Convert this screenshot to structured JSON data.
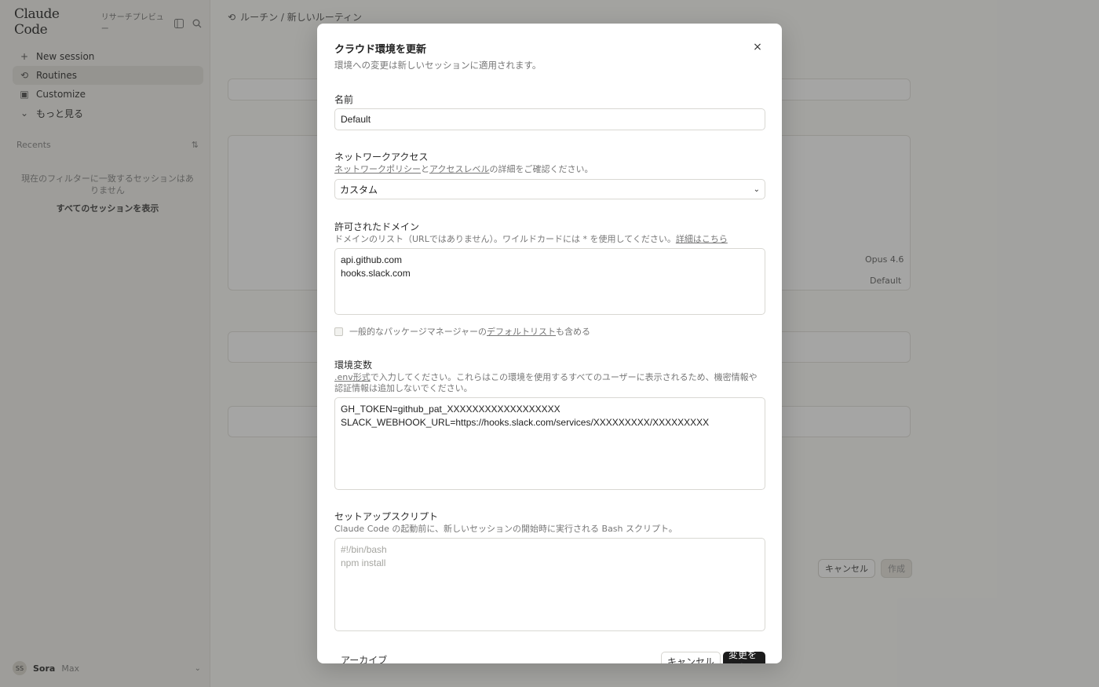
{
  "sidebar": {
    "brand": "Claude Code",
    "preview_tag": "リサーチプレビュー",
    "nav": [
      {
        "icon": "+",
        "label": "New session"
      },
      {
        "icon": "⟲",
        "label": "Routines"
      },
      {
        "icon": "▣",
        "label": "Customize"
      },
      {
        "icon": "⌄",
        "label": "もっと見る"
      }
    ],
    "recents_label": "Recents",
    "recents_icon": "⇅",
    "empty_message": "現在のフィルターに一致するセッションはありません",
    "show_all": "すべてのセッションを表示",
    "user": {
      "initials": "SS",
      "name": "Sora",
      "plan": "Max"
    }
  },
  "main": {
    "breadcrumb": "ルーチン / 新しいルーティン",
    "model_label": "Opus 4.6",
    "env_label": "Default",
    "cancel_label": "キャンセル",
    "create_label": "作成"
  },
  "modal": {
    "title": "クラウド環境を更新",
    "subtitle": "環境への変更は新しいセッションに適用されます。",
    "close_label": "×",
    "name": {
      "label": "名前",
      "value": "Default"
    },
    "network": {
      "label": "ネットワークアクセス",
      "hint_link1": "ネットワークポリシー",
      "hint_mid": "と",
      "hint_link2": "アクセスレベル",
      "hint_end": "の詳細をご確認ください。",
      "value": "カスタム"
    },
    "domains": {
      "label": "許可されたドメイン",
      "hint": "ドメインのリスト（URLではありません）。ワイルドカードには * を使用してください。",
      "hint_link": "詳細はこちら",
      "value": "api.github.com\nhooks.slack.com"
    },
    "default_list": {
      "pre": "一般的なパッケージマネージャーの",
      "link": "デフォルトリスト",
      "post": "も含める"
    },
    "env_vars": {
      "label": "環境変数",
      "hint_link": ".env形式",
      "hint_line1": "で入力してください。これらはこの環境を使用するすべてのユーザーに表示されるため、機密情報や",
      "hint_line2": "認証情報は追加しないでください。",
      "value": "GH_TOKEN=github_pat_XXXXXXXXXXXXXXXXXX\nSLACK_WEBHOOK_URL=https://hooks.slack.com/services/XXXXXXXXX/XXXXXXXXX"
    },
    "setup": {
      "label": "セットアップスクリプト",
      "hint": "Claude Code の起動前に、新しいセッションの開始時に実行される Bash スクリプト。",
      "placeholder": "#!/bin/bash\nnpm install"
    },
    "archive_label": "アーカイブ",
    "cancel_label": "キャンセル",
    "save_label": "変更を保存"
  }
}
